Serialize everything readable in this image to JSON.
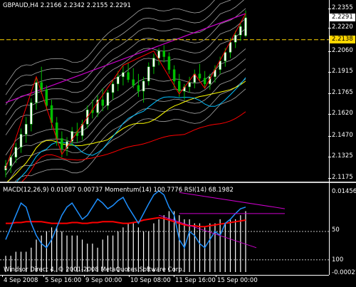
{
  "chart": {
    "title": "GBPAUD,H4  2.2166 2.2342 2.2155 2.2291",
    "indicator_title": "MACD(12,26,9) 0.01087 0.00737  Momentum(14) 100.7776  RSI(14) 68.1982",
    "copyright": "Windsor Direct 4, © 2001-2008 MetaQuotes Software Corp.",
    "current_price": "2.2291",
    "ask_line": "2.2138",
    "price_axis": [
      "2.2355",
      "2.2220",
      "2.2060",
      "2.1915",
      "2.1765",
      "2.1620",
      "2.1470",
      "2.1325",
      "2.1175"
    ],
    "ind_axis": [
      "0.01456",
      "50",
      "100",
      "-0.00021"
    ],
    "time_axis": [
      "4 Sep 2008",
      "5 Sep 16:00",
      "9 Sep 00:00",
      "10 Sep 08:00",
      "11 Sep 16:00",
      "15 Sep 00:00"
    ],
    "colors": {
      "background": "#000000",
      "bull_candle": "#ffffff",
      "bear_candle": "#00c000",
      "envelope": "#c0c0c0",
      "upper_band": "#cc00cc",
      "zigzag": "#ff0000",
      "ask": "#ffd700",
      "ma_yellow": "#ffff00",
      "ma_cyan": "#00bfff",
      "macd_line": "#ff0000",
      "momentum": "#1e90ff",
      "histogram": "#ffffff"
    }
  },
  "chart_data": {
    "type": "candlestick",
    "symbol": "GBPAUD",
    "timeframe": "H4",
    "ylim": [
      2.1175,
      2.2355
    ],
    "candles": [
      [
        2.123,
        2.13,
        2.118,
        2.126
      ],
      [
        2.126,
        2.134,
        2.121,
        2.132
      ],
      [
        2.132,
        2.142,
        2.128,
        2.139
      ],
      [
        2.139,
        2.152,
        2.135,
        2.148
      ],
      [
        2.148,
        2.16,
        2.142,
        2.155
      ],
      [
        2.155,
        2.173,
        2.15,
        2.17
      ],
      [
        2.17,
        2.188,
        2.165,
        2.184
      ],
      [
        2.184,
        2.195,
        2.176,
        2.179
      ],
      [
        2.179,
        2.182,
        2.165,
        2.168
      ],
      [
        2.168,
        2.172,
        2.152,
        2.156
      ],
      [
        2.156,
        2.16,
        2.14,
        2.145
      ],
      [
        2.145,
        2.15,
        2.132,
        2.138
      ],
      [
        2.138,
        2.146,
        2.133,
        2.143
      ],
      [
        2.143,
        2.153,
        2.14,
        2.15
      ],
      [
        2.15,
        2.156,
        2.142,
        2.147
      ],
      [
        2.147,
        2.158,
        2.144,
        2.155
      ],
      [
        2.155,
        2.168,
        2.152,
        2.165
      ],
      [
        2.165,
        2.172,
        2.159,
        2.163
      ],
      [
        2.163,
        2.175,
        2.16,
        2.172
      ],
      [
        2.172,
        2.18,
        2.164,
        2.168
      ],
      [
        2.168,
        2.179,
        2.165,
        2.177
      ],
      [
        2.177,
        2.186,
        2.172,
        2.183
      ],
      [
        2.183,
        2.192,
        2.178,
        2.188
      ],
      [
        2.188,
        2.196,
        2.182,
        2.191
      ],
      [
        2.191,
        2.198,
        2.184,
        2.186
      ],
      [
        2.186,
        2.194,
        2.18,
        2.182
      ],
      [
        2.182,
        2.19,
        2.174,
        2.178
      ],
      [
        2.178,
        2.188,
        2.17,
        2.185
      ],
      [
        2.185,
        2.198,
        2.182,
        2.195
      ],
      [
        2.195,
        2.204,
        2.19,
        2.201
      ],
      [
        2.201,
        2.208,
        2.196,
        2.206
      ],
      [
        2.206,
        2.21,
        2.198,
        2.202
      ],
      [
        2.202,
        2.205,
        2.19,
        2.193
      ],
      [
        2.193,
        2.196,
        2.18,
        2.185
      ],
      [
        2.185,
        2.19,
        2.174,
        2.178
      ],
      [
        2.178,
        2.183,
        2.172,
        2.181
      ],
      [
        2.181,
        2.188,
        2.177,
        2.184
      ],
      [
        2.184,
        2.193,
        2.18,
        2.19
      ],
      [
        2.19,
        2.197,
        2.185,
        2.187
      ],
      [
        2.187,
        2.192,
        2.18,
        2.183
      ],
      [
        2.183,
        2.19,
        2.179,
        2.188
      ],
      [
        2.188,
        2.196,
        2.184,
        2.193
      ],
      [
        2.193,
        2.202,
        2.19,
        2.199
      ],
      [
        2.199,
        2.208,
        2.195,
        2.205
      ],
      [
        2.205,
        2.215,
        2.201,
        2.212
      ],
      [
        2.212,
        2.22,
        2.208,
        2.217
      ],
      [
        2.217,
        2.226,
        2.213,
        2.223
      ],
      [
        2.2166,
        2.2342,
        2.2155,
        2.2291
      ]
    ],
    "ind_ylim": [
      -0.00021,
      0.01456
    ],
    "momentum": [
      40,
      55,
      70,
      85,
      80,
      60,
      45,
      35,
      30,
      40,
      55,
      70,
      80,
      85,
      75,
      65,
      70,
      80,
      90,
      85,
      78,
      82,
      88,
      92,
      80,
      70,
      60,
      72,
      84,
      95,
      100,
      95,
      80,
      70,
      40,
      30,
      50,
      45,
      35,
      30,
      40,
      50,
      45,
      60,
      65,
      72,
      78,
      80
    ],
    "macd_signal": [
      60,
      60,
      61,
      61,
      62,
      62,
      62,
      62,
      61,
      60,
      60,
      60,
      60,
      61,
      61,
      60,
      60,
      61,
      61,
      62,
      62,
      62,
      61,
      60,
      60,
      61,
      62,
      64,
      65,
      66,
      67,
      66,
      64,
      62,
      60,
      58,
      57,
      57,
      56,
      56,
      57,
      58,
      59,
      60,
      61,
      62,
      63,
      64
    ],
    "histogram": [
      20,
      20,
      25,
      25,
      25,
      30,
      40,
      45,
      50,
      55,
      55,
      50,
      45,
      45,
      45,
      40,
      35,
      35,
      30,
      40,
      45,
      45,
      50,
      55,
      60,
      60,
      55,
      50,
      50,
      60,
      65,
      70,
      75,
      75,
      70,
      65,
      65,
      60,
      60,
      55,
      60,
      60,
      65,
      60,
      65,
      65,
      70,
      75
    ]
  }
}
